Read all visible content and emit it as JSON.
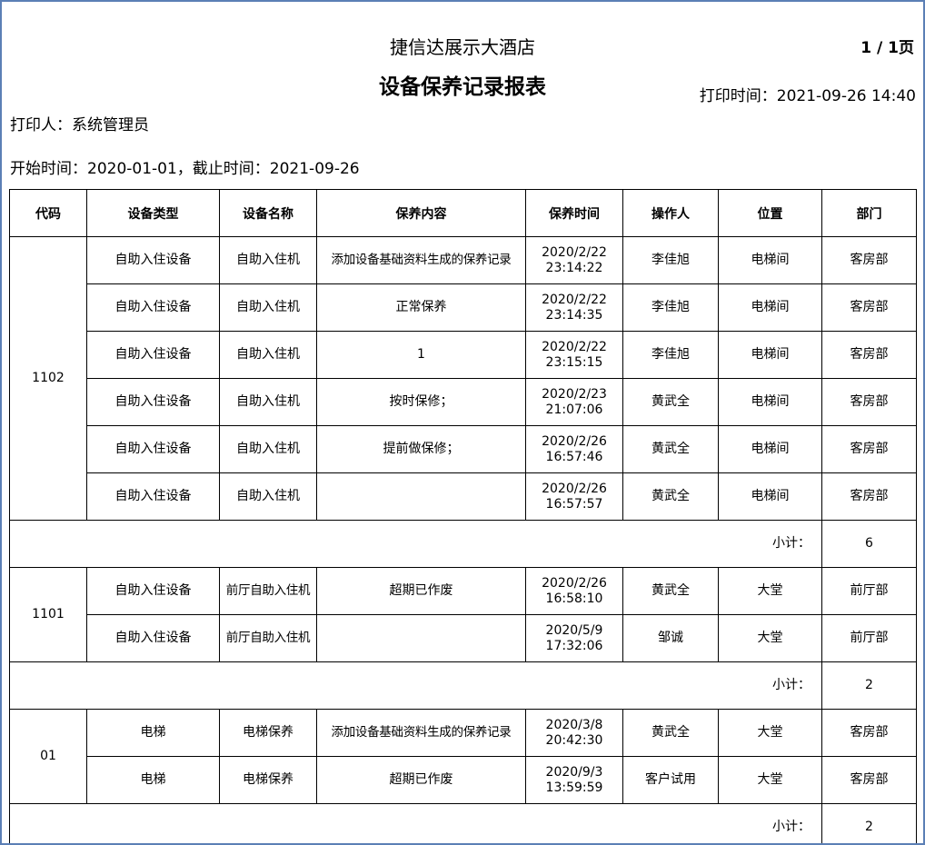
{
  "header": {
    "hotel_name": "捷信达展示大酒店",
    "page_indicator": "1 / 1页",
    "report_title": "设备保养记录报表",
    "print_time": "打印时间：2021-09-26 14:40",
    "printer": "打印人：系统管理员",
    "period": "开始时间：2020-01-01，截止时间：2021-09-26"
  },
  "table": {
    "columns": [
      "代码",
      "设备类型",
      "设备名称",
      "保养内容",
      "保养时间",
      "操作人",
      "位置",
      "部门"
    ],
    "subtotal_label": "小计：",
    "groups": [
      {
        "code": "1102",
        "subtotal": "6",
        "rows": [
          {
            "type": "自助入住设备",
            "name": "自助入住机",
            "content": "添加设备基础资料生成的保养记录",
            "date": "2020/2/22",
            "time": "23:14:22",
            "operator": "李佳旭",
            "location": "电梯间",
            "department": "客房部"
          },
          {
            "type": "自助入住设备",
            "name": "自助入住机",
            "content": "正常保养",
            "date": "2020/2/22",
            "time": "23:14:35",
            "operator": "李佳旭",
            "location": "电梯间",
            "department": "客房部"
          },
          {
            "type": "自助入住设备",
            "name": "自助入住机",
            "content": "1",
            "date": "2020/2/22",
            "time": "23:15:15",
            "operator": "李佳旭",
            "location": "电梯间",
            "department": "客房部"
          },
          {
            "type": "自助入住设备",
            "name": "自助入住机",
            "content": "按时保修；",
            "date": "2020/2/23",
            "time": "21:07:06",
            "operator": "黄武全",
            "location": "电梯间",
            "department": "客房部"
          },
          {
            "type": "自助入住设备",
            "name": "自助入住机",
            "content": "提前做保修；",
            "date": "2020/2/26",
            "time": "16:57:46",
            "operator": "黄武全",
            "location": "电梯间",
            "department": "客房部"
          },
          {
            "type": "自助入住设备",
            "name": "自助入住机",
            "content": "",
            "date": "2020/2/26",
            "time": "16:57:57",
            "operator": "黄武全",
            "location": "电梯间",
            "department": "客房部"
          }
        ]
      },
      {
        "code": "1101",
        "subtotal": "2",
        "rows": [
          {
            "type": "自助入住设备",
            "name": "前厅自助入住机",
            "content": "超期已作废",
            "date": "2020/2/26",
            "time": "16:58:10",
            "operator": "黄武全",
            "location": "大堂",
            "department": "前厅部"
          },
          {
            "type": "自助入住设备",
            "name": "前厅自助入住机",
            "content": "",
            "date": "2020/5/9",
            "time": "17:32:06",
            "operator": "邹诚",
            "location": "大堂",
            "department": "前厅部"
          }
        ]
      },
      {
        "code": "01",
        "subtotal": "2",
        "rows": [
          {
            "type": "电梯",
            "name": "电梯保养",
            "content": "添加设备基础资料生成的保养记录",
            "date": "2020/3/8",
            "time": "20:42:30",
            "operator": "黄武全",
            "location": "大堂",
            "department": "客房部"
          },
          {
            "type": "电梯",
            "name": "电梯保养",
            "content": "超期已作废",
            "date": "2020/9/3",
            "time": "13:59:59",
            "operator": "客户试用",
            "location": "大堂",
            "department": "客房部"
          }
        ]
      }
    ]
  }
}
